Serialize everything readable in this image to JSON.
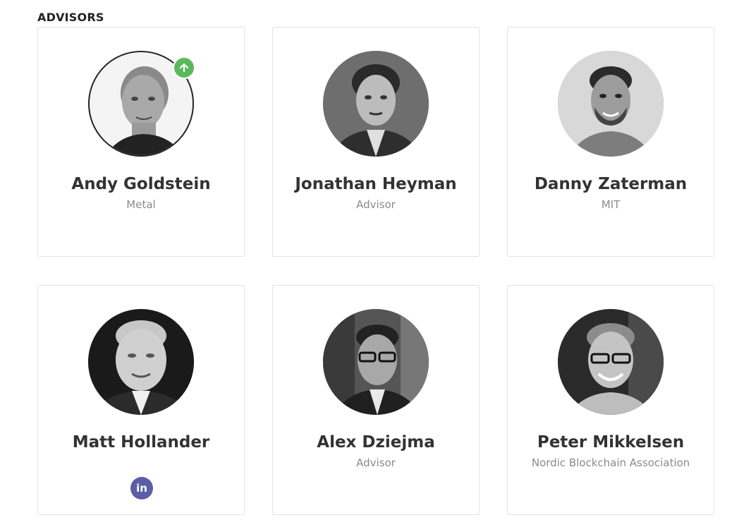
{
  "section": {
    "title": "ADVISORS"
  },
  "advisors": [
    {
      "name": "Andy Goldstein",
      "role": "Metal",
      "photo": "andy-goldstein-photo"
    },
    {
      "name": "Jonathan Heyman",
      "role": "Advisor",
      "photo": "jonathan-heyman-photo"
    },
    {
      "name": "Danny Zaterman",
      "role": "MIT",
      "photo": "danny-zaterman-photo"
    },
    {
      "name": "Matt Hollander",
      "role": "",
      "photo": "matt-hollander-photo",
      "social": {
        "linkedin_label": "in",
        "icon": "linkedin-icon"
      }
    },
    {
      "name": "Alex Dziejma",
      "role": "Advisor",
      "photo": "alex-dziejma-photo"
    },
    {
      "name": "Peter Mikkelsen",
      "role": "Nordic Blockchain Association",
      "photo": "peter-mikkelsen-photo"
    }
  ],
  "badge": {
    "icon": "arrow-up-icon"
  },
  "colors": {
    "badge_green": "#5cb85c",
    "linkedin_purple": "#5b5ea6",
    "name_text": "#333333",
    "role_text": "#8a8a8a",
    "card_border": "#e2e2e2"
  }
}
